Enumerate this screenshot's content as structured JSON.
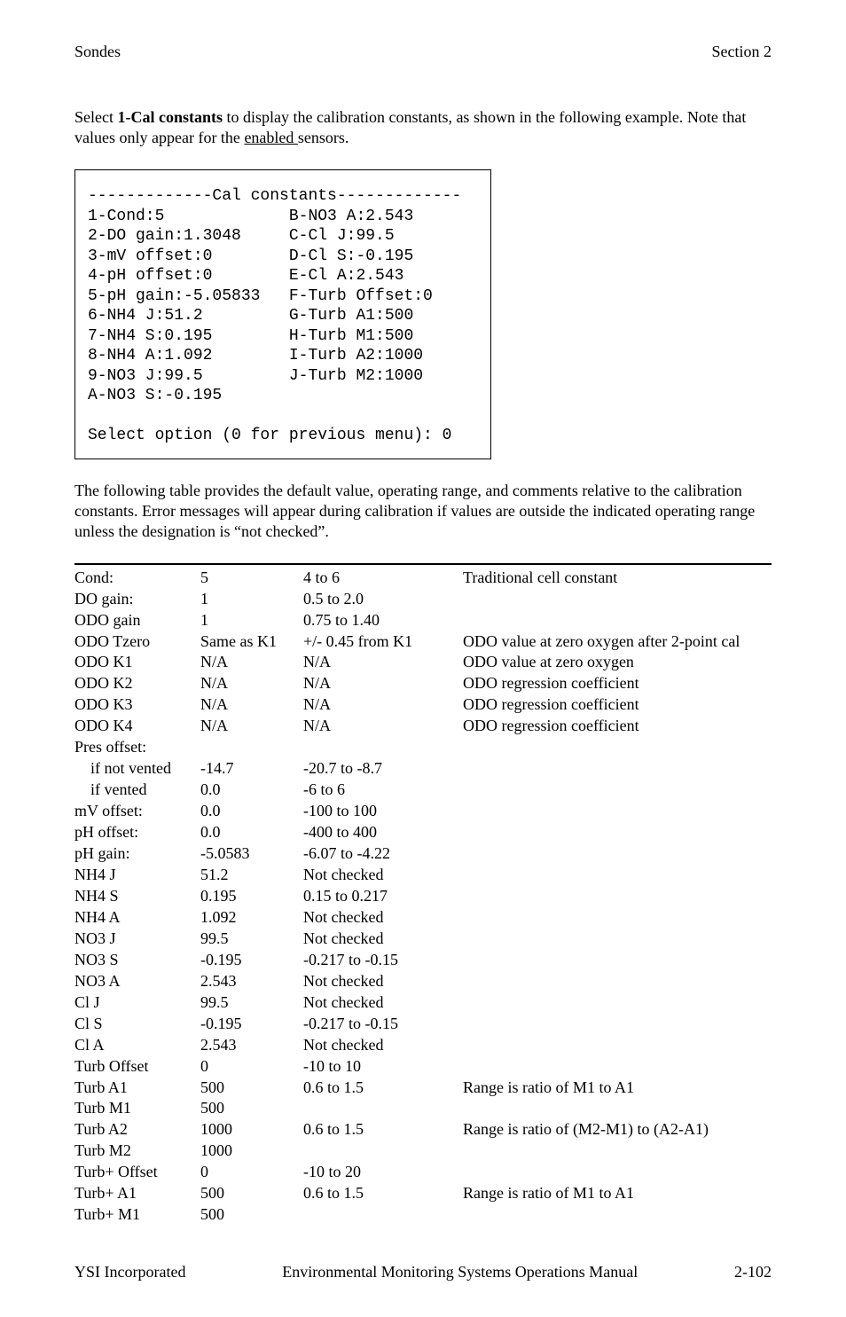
{
  "header": {
    "left": "Sondes",
    "right": "Section 2"
  },
  "para1_pre": "Select ",
  "para1_bold": "1-Cal constants",
  "para1_mid": " to display the calibration constants, as shown in the following example.  Note that values only appear for the ",
  "para1_underline": "enabled ",
  "para1_post": "sensors.",
  "codebox": "-------------Cal constants-------------\n1-Cond:5             B-NO3 A:2.543\n2-DO gain:1.3048     C-Cl J:99.5\n3-mV offset:0        D-Cl S:-0.195\n4-pH offset:0        E-Cl A:2.543\n5-pH gain:-5.05833   F-Turb Offset:0\n6-NH4 J:51.2         G-Turb A1:500\n7-NH4 S:0.195        H-Turb M1:500\n8-NH4 A:1.092        I-Turb A2:1000\n9-NO3 J:99.5         J-Turb M2:1000\nA-NO3 S:-0.195\n\nSelect option (0 for previous menu): 0",
  "para2": "The following table provides the default value, operating range, and comments relative to the calibration constants.  Error messages will appear during calibration if values are outside the indicated operating range unless the designation is “not checked”.",
  "table": [
    {
      "name": "Cond:",
      "def": "5",
      "range": "4 to 6",
      "comment": "Traditional cell constant",
      "indent": false
    },
    {
      "name": "DO gain:",
      "def": "1",
      "range": "0.5 to 2.0",
      "comment": "",
      "indent": false
    },
    {
      "name": "ODO gain",
      "def": "1",
      "range": "0.75 to 1.40",
      "comment": "",
      "indent": false
    },
    {
      "name": "ODO Tzero",
      "def": "Same as K1",
      "range": "+/- 0.45 from K1",
      "comment": "ODO value at zero oxygen after 2-point cal",
      "indent": false
    },
    {
      "name": "ODO K1",
      "def": "N/A",
      "range": "N/A",
      "comment": "ODO value at zero oxygen",
      "indent": false
    },
    {
      "name": "ODO K2",
      "def": "N/A",
      "range": "N/A",
      "comment": "ODO regression coefficient",
      "indent": false
    },
    {
      "name": "ODO K3",
      "def": "N/A",
      "range": "N/A",
      "comment": "ODO regression coefficient",
      "indent": false
    },
    {
      "name": "ODO K4",
      "def": "N/A",
      "range": "N/A",
      "comment": "ODO regression coefficient",
      "indent": false
    },
    {
      "name": "Pres offset:",
      "def": "",
      "range": "",
      "comment": "",
      "indent": false
    },
    {
      "name": "if not vented",
      "def": "-14.7",
      "range": "-20.7 to -8.7",
      "comment": "",
      "indent": true
    },
    {
      "name": "if vented",
      "def": "0.0",
      "range": "-6 to 6",
      "comment": "",
      "indent": true
    },
    {
      "name": "mV offset:",
      "def": "0.0",
      "range": "-100 to 100",
      "comment": "",
      "indent": false
    },
    {
      "name": "pH offset:",
      "def": "0.0",
      "range": "-400 to 400",
      "comment": "",
      "indent": false
    },
    {
      "name": "pH gain:",
      "def": "-5.0583",
      "range": "-6.07 to -4.22",
      "comment": "",
      "indent": false
    },
    {
      "name": "NH4  J",
      "def": "51.2",
      "range": "Not checked",
      "comment": "",
      "indent": false
    },
    {
      "name": "NH4  S",
      "def": "0.195",
      "range": "0.15 to 0.217",
      "comment": "",
      "indent": false
    },
    {
      "name": "NH4  A",
      "def": "1.092",
      "range": "Not checked",
      "comment": "",
      "indent": false
    },
    {
      "name": "NO3  J",
      "def": "99.5",
      "range": "Not checked",
      "comment": "",
      "indent": false
    },
    {
      "name": "NO3  S",
      "def": "-0.195",
      "range": "-0.217 to -0.15",
      "comment": "",
      "indent": false
    },
    {
      "name": "NO3  A",
      "def": "2.543",
      "range": "Not checked",
      "comment": "",
      "indent": false
    },
    {
      "name": "Cl  J",
      "def": "99.5",
      "range": "Not checked",
      "comment": "",
      "indent": false
    },
    {
      "name": "Cl  S",
      "def": "-0.195",
      "range": "-0.217 to -0.15",
      "comment": "",
      "indent": false
    },
    {
      "name": "Cl  A",
      "def": "2.543",
      "range": "Not checked",
      "comment": "",
      "indent": false
    },
    {
      "name": "Turb Offset",
      "def": "0",
      "range": "-10 to 10",
      "comment": "",
      "indent": false
    },
    {
      "name": "Turb  A1",
      "def": "500",
      "range": "0.6 to 1.5",
      "comment": "Range is ratio of M1 to A1",
      "indent": false
    },
    {
      "name": "Turb  M1",
      "def": "500",
      "range": "",
      "comment": "",
      "indent": false
    },
    {
      "name": "Turb  A2",
      "def": "1000",
      "range": "0.6 to 1.5",
      "comment": "Range is ratio of (M2-M1) to (A2-A1)",
      "indent": false
    },
    {
      "name": "Turb  M2",
      "def": "1000",
      "range": "",
      "comment": "",
      "indent": false
    },
    {
      "name": "Turb+ Offset",
      "def": "0",
      "range": "-10 to 20",
      "comment": "",
      "indent": false
    },
    {
      "name": "Turb+  A1",
      "def": "500",
      "range": "0.6 to 1.5",
      "comment": "Range is ratio of M1 to A1",
      "indent": false
    },
    {
      "name": "Turb+  M1",
      "def": "500",
      "range": "",
      "comment": "",
      "indent": false
    }
  ],
  "footer": {
    "left": "YSI Incorporated",
    "center": "Environmental Monitoring Systems Operations Manual",
    "right": "2-102"
  }
}
